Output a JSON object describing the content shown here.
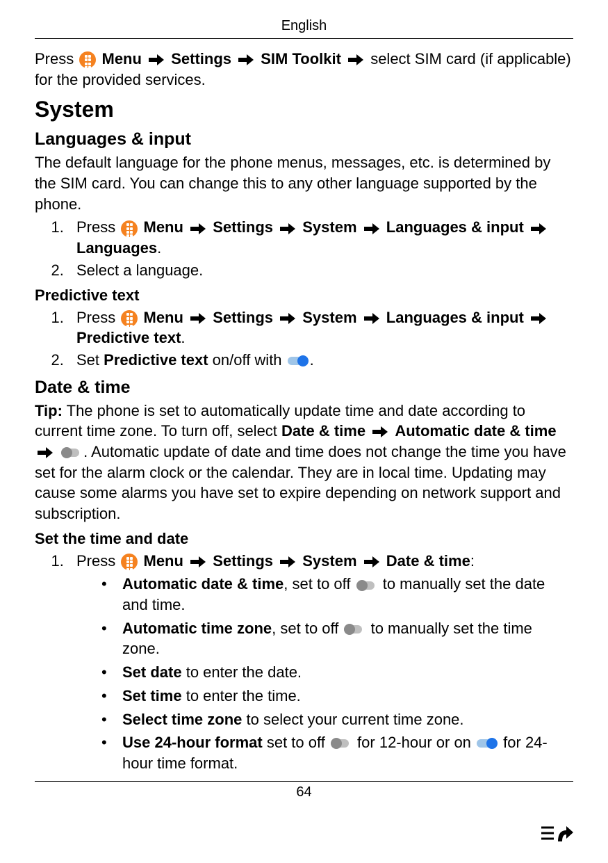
{
  "header": {
    "language": "English"
  },
  "intro": {
    "press": "Press",
    "menu": "Menu",
    "settings": "Settings",
    "sim_toolkit": "SIM Toolkit",
    "rest": " select SIM card (if applicable) for the provided services."
  },
  "system": {
    "title": "System",
    "lang_input": {
      "title": "Languages & input",
      "desc": "The default language for the phone menus, messages, etc. is determined by the SIM card. You can change this to any other language supported by the phone.",
      "steps1": {
        "press": "Press",
        "menu": "Menu",
        "settings": "Settings",
        "system": "System",
        "lang_input": "Languages & input",
        "languages": "Languages",
        "step2": "Select a language."
      },
      "predictive": {
        "title": "Predictive text",
        "press": "Press",
        "menu": "Menu",
        "settings": "Settings",
        "system": "System",
        "lang_input": "Languages & input",
        "predictive_text": "Predictive text",
        "set_pre1": "Set ",
        "set_pre_bold": "Predictive text",
        "set_pre2": " on/off with ",
        "period": "."
      }
    },
    "date_time": {
      "title": "Date & time",
      "tip_label": "Tip:",
      "tip1": " The phone is set to automatically update time and date according to current time zone. To turn off, select ",
      "date_time_b": "Date & time",
      "auto_dt_b": "Automatic date & time",
      "tip2": ". Automatic update of date and time does not change the time you have set for the alarm clock or the calendar. They are in local time. Updating may cause some alarms you have set to expire depending on network support and subscription.",
      "set_title": "Set the time and date",
      "step1": {
        "press": "Press",
        "menu": "Menu",
        "settings": "Settings",
        "system": "System",
        "date_time": "Date & time",
        "colon": ":"
      },
      "bullets": {
        "b1a": "Automatic date & time",
        "b1b": ", set to off ",
        "b1c": " to manually set the date and time.",
        "b2a": "Automatic time zone",
        "b2b": ", set to off ",
        "b2c": " to manually set the time zone.",
        "b3a": "Set date",
        "b3b": " to enter the date.",
        "b4a": "Set time",
        "b4b": " to enter the time.",
        "b5a": "Select time zone",
        "b5b": " to select your current time zone.",
        "b6a": "Use 24-hour format",
        "b6b": " set to off ",
        "b6c": " for 12-hour or on ",
        "b6d": " for 24-hour time format."
      }
    }
  },
  "page_number": "64"
}
